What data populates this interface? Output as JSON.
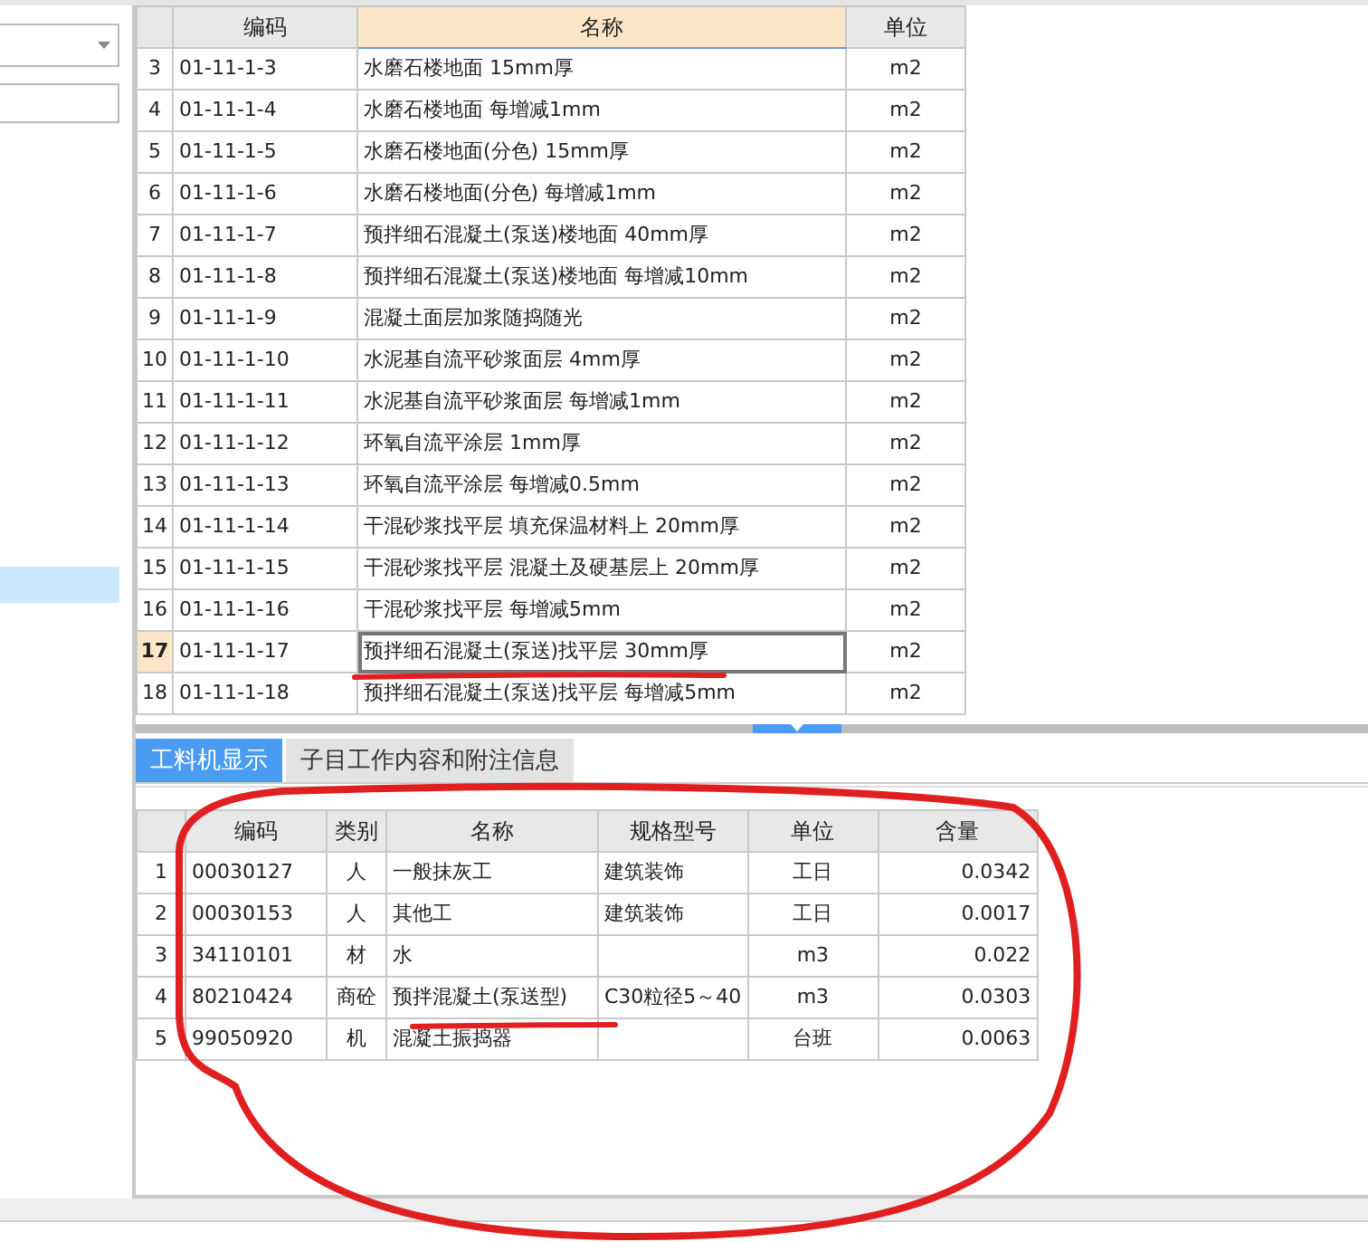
{
  "upper_table": {
    "columns": [
      {
        "label": "编码",
        "highlighted": false
      },
      {
        "label": "名称",
        "highlighted": true
      },
      {
        "label": "单位",
        "highlighted": false
      }
    ],
    "rows": [
      {
        "num": "3",
        "code": "01-11-1-3",
        "name": "水磨石楼地面 15mm厚",
        "unit": "m2",
        "selected": false
      },
      {
        "num": "4",
        "code": "01-11-1-4",
        "name": "水磨石楼地面 每增减1mm",
        "unit": "m2",
        "selected": false
      },
      {
        "num": "5",
        "code": "01-11-1-5",
        "name": "水磨石楼地面(分色) 15mm厚",
        "unit": "m2",
        "selected": false
      },
      {
        "num": "6",
        "code": "01-11-1-6",
        "name": "水磨石楼地面(分色) 每增减1mm",
        "unit": "m2",
        "selected": false
      },
      {
        "num": "7",
        "code": "01-11-1-7",
        "name": "预拌细石混凝土(泵送)楼地面 40mm厚",
        "unit": "m2",
        "selected": false
      },
      {
        "num": "8",
        "code": "01-11-1-8",
        "name": "预拌细石混凝土(泵送)楼地面 每增减10mm",
        "unit": "m2",
        "selected": false
      },
      {
        "num": "9",
        "code": "01-11-1-9",
        "name": "混凝土面层加浆随捣随光",
        "unit": "m2",
        "selected": false
      },
      {
        "num": "10",
        "code": "01-11-1-10",
        "name": "水泥基自流平砂浆面层 4mm厚",
        "unit": "m2",
        "selected": false
      },
      {
        "num": "11",
        "code": "01-11-1-11",
        "name": "水泥基自流平砂浆面层 每增减1mm",
        "unit": "m2",
        "selected": false
      },
      {
        "num": "12",
        "code": "01-11-1-12",
        "name": "环氧自流平涂层 1mm厚",
        "unit": "m2",
        "selected": false
      },
      {
        "num": "13",
        "code": "01-11-1-13",
        "name": "环氧自流平涂层 每增减0.5mm",
        "unit": "m2",
        "selected": false
      },
      {
        "num": "14",
        "code": "01-11-1-14",
        "name": "干混砂浆找平层 填充保温材料上 20mm厚",
        "unit": "m2",
        "selected": false
      },
      {
        "num": "15",
        "code": "01-11-1-15",
        "name": "干混砂浆找平层 混凝土及硬基层上 20mm厚",
        "unit": "m2",
        "selected": false
      },
      {
        "num": "16",
        "code": "01-11-1-16",
        "name": "干混砂浆找平层 每增减5mm",
        "unit": "m2",
        "selected": false
      },
      {
        "num": "17",
        "code": "01-11-1-17",
        "name": "预拌细石混凝土(泵送)找平层 30mm厚",
        "unit": "m2",
        "selected": true
      },
      {
        "num": "18",
        "code": "01-11-1-18",
        "name": "预拌细石混凝土(泵送)找平层 每增减5mm",
        "unit": "m2",
        "selected": false
      }
    ]
  },
  "tabs": [
    {
      "label": "工料机显示",
      "selected": true
    },
    {
      "label": "子目工作内容和附注信息",
      "selected": false
    }
  ],
  "lower_table": {
    "columns": [
      "编码",
      "类别",
      "名称",
      "规格型号",
      "单位",
      "含量"
    ],
    "rows": [
      {
        "num": "1",
        "code": "00030127",
        "type": "人",
        "name": "一般抹灰工",
        "spec": "建筑装饰",
        "unit": "工日",
        "amount": "0.0342"
      },
      {
        "num": "2",
        "code": "00030153",
        "type": "人",
        "name": "其他工",
        "spec": "建筑装饰",
        "unit": "工日",
        "amount": "0.0017"
      },
      {
        "num": "3",
        "code": "34110101",
        "type": "材",
        "name": "水",
        "unit": "m3",
        "amount": "0.022"
      },
      {
        "num": "4",
        "code": "80210424",
        "type": "商砼",
        "name": "预拌混凝土(泵送型)",
        "spec": "C30粒径5～40",
        "unit": "m3",
        "amount": "0.0303"
      },
      {
        "num": "5",
        "code": "99050920",
        "type": "机",
        "name": "混凝土振捣器",
        "unit": "台班",
        "amount": "0.0063"
      }
    ]
  }
}
